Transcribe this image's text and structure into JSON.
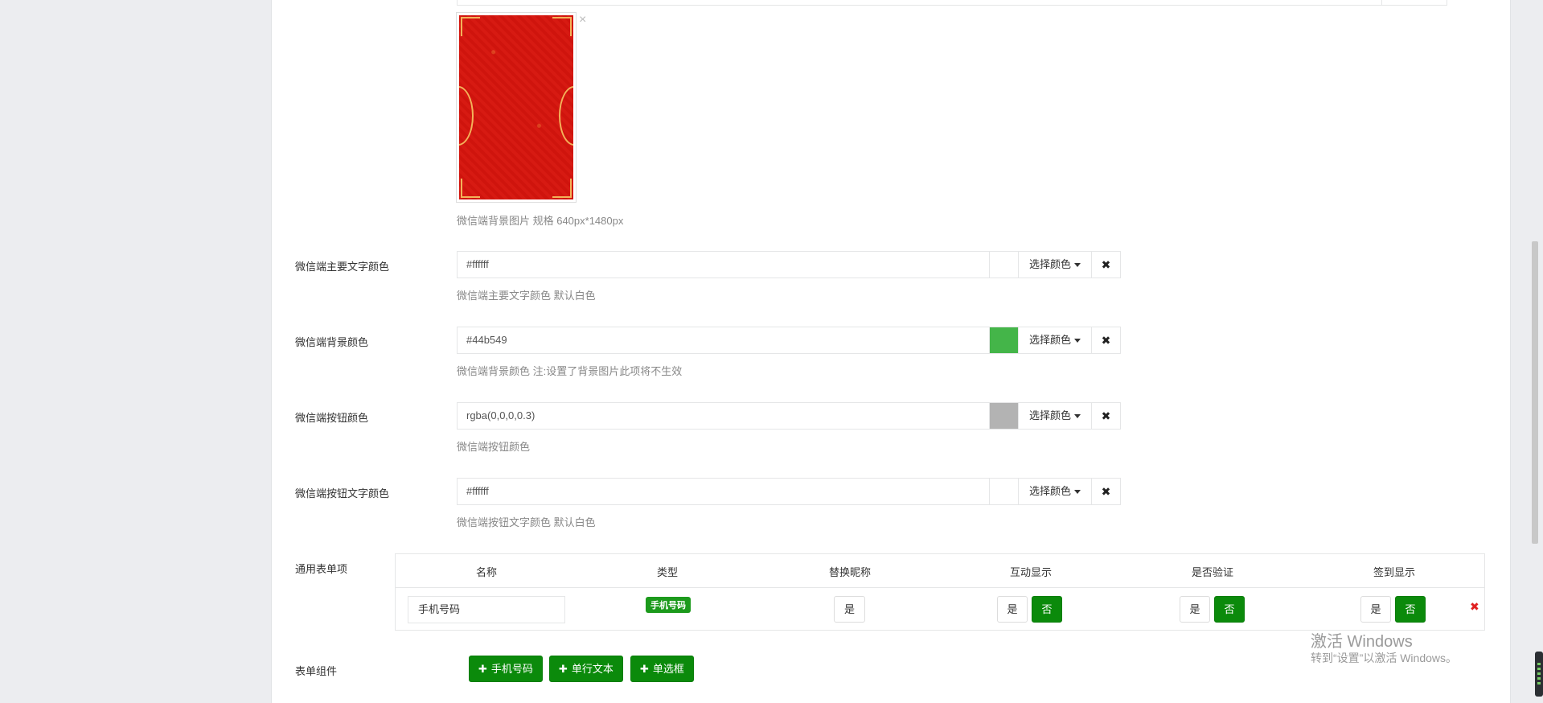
{
  "background_image": {
    "help": "微信端背景图片 规格 640px*1480px",
    "remove_glyph": "×"
  },
  "color_fields": [
    {
      "label": "微信端主要文字颜色",
      "value": "#ffffff",
      "swatch": "#ffffff",
      "pick_label": "选择颜色",
      "clear_glyph": "✖",
      "help": "微信端主要文字颜色 默认白色"
    },
    {
      "label": "微信端背景颜色",
      "value": "#44b549",
      "swatch": "#44b549",
      "pick_label": "选择颜色",
      "clear_glyph": "✖",
      "help": "微信端背景颜色 注:设置了背景图片此项将不生效"
    },
    {
      "label": "微信端按钮颜色",
      "value": "rgba(0,0,0,0.3)",
      "swatch": "#b3b3b3",
      "pick_label": "选择颜色",
      "clear_glyph": "✖",
      "help": "微信端按钮颜色"
    },
    {
      "label": "微信端按钮文字颜色",
      "value": "#ffffff",
      "swatch": "#ffffff",
      "pick_label": "选择颜色",
      "clear_glyph": "✖",
      "help": "微信端按钮文字颜色 默认白色"
    }
  ],
  "form_items": {
    "label": "通用表单项",
    "headers": [
      "名称",
      "类型",
      "替换昵称",
      "互动显示",
      "是否验证",
      "签到显示"
    ],
    "row": {
      "name": "手机号码",
      "type_badge": "手机号码",
      "replace_nick": "是",
      "interact": {
        "yes": "是",
        "no": "否"
      },
      "verify": {
        "yes": "是",
        "no": "否"
      },
      "signin": {
        "yes": "是",
        "no": "否"
      },
      "delete_glyph": "✖"
    }
  },
  "components": {
    "label": "表单组件",
    "buttons": [
      "手机号码",
      "单行文本",
      "单选框"
    ],
    "plus_glyph": "✚"
  },
  "watermark": {
    "line1": "激活 Windows",
    "line2": "转到“设置”以激活 Windows。"
  }
}
